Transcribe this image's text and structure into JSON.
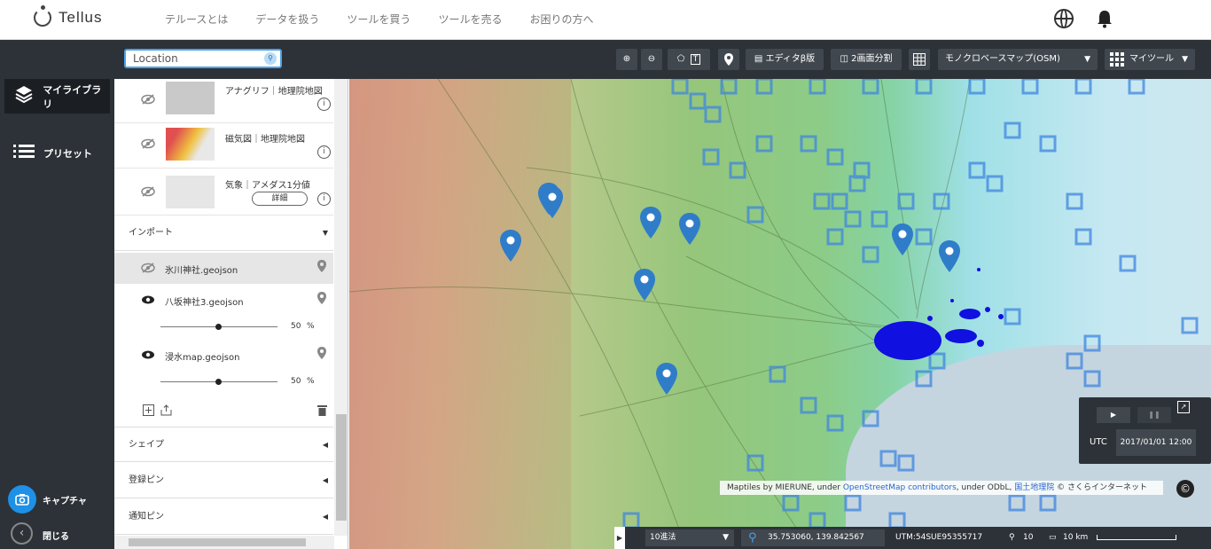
{
  "app": {
    "name": "Tellus"
  },
  "nav": {
    "links": [
      "テルースとは",
      "データを扱う",
      "ツールを買う",
      "ツールを売る",
      "お困りの方へ"
    ]
  },
  "rail": {
    "library": "マイライブラリ",
    "preset": "プリセット",
    "capture": "キャプチャ",
    "close": "閉じる"
  },
  "toolbar": {
    "search_value": "Location",
    "editor": "エディタβ版",
    "split": "2画面分割",
    "basemap": "モノクロベースマップ(OSM)",
    "mytools": "マイツール"
  },
  "layers": [
    {
      "title": "アナグリフ｜地理院地図"
    },
    {
      "title": "磁気図｜地理院地図"
    },
    {
      "title": "気象｜アメダス1分値",
      "detail": "詳細"
    }
  ],
  "import": {
    "header": "インポート",
    "items": [
      {
        "name": "氷川神社.geojson"
      },
      {
        "name": "八坂神社3.geojson",
        "opacity": "50",
        "unit": "%"
      },
      {
        "name": "浸水map.geojson",
        "opacity": "50",
        "unit": "%"
      }
    ]
  },
  "sections": [
    "シェイプ",
    "登録ピン",
    "通知ピン"
  ],
  "map": {
    "attribution_pre": "Maptiles by MIERUNE, under ",
    "attribution_link1": "OpenStreetMap contributors",
    "attribution_mid": ", under ODbL, ",
    "attribution_link2": "国土地理院",
    "attribution_post": " © さくらインターネット",
    "utc_label": "UTC",
    "utc_value": "2017/01/01 12:00",
    "notation": "10進法",
    "coords": "35.753060, 139.842567",
    "utm": "UTM:54SUE95355717",
    "zoom": "10",
    "scale": "10 km"
  },
  "colors": {
    "dark": "#2d3238",
    "accent": "#1e90e6",
    "grid": "#3f86e0",
    "cluster": "#1010e0"
  }
}
